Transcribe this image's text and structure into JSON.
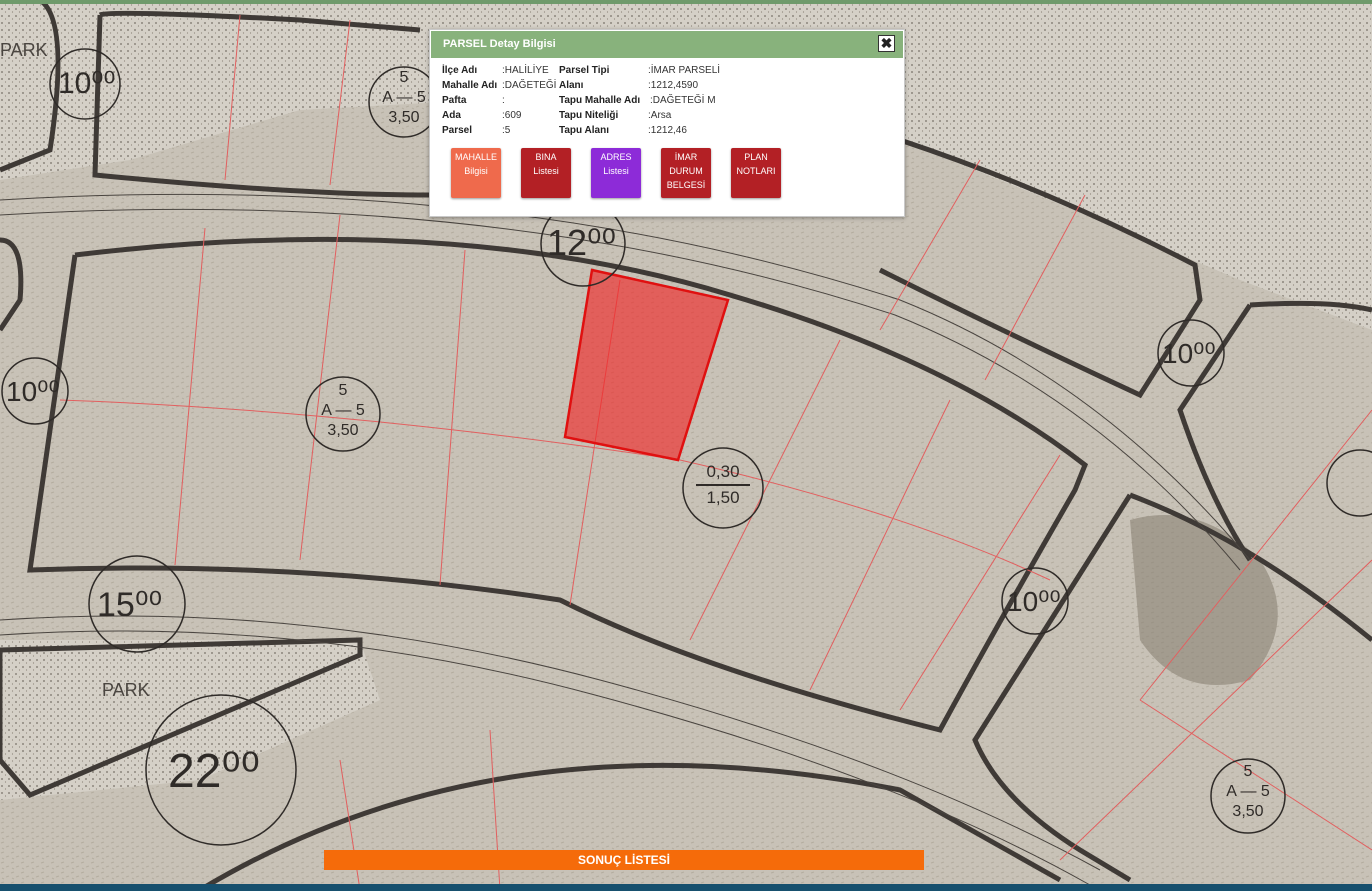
{
  "popup": {
    "title": "PARSEL Detay Bilgisi",
    "close_icon": "close-icon",
    "left_rows": [
      {
        "label": "İlçe Adı",
        "value": ":HALİLİYE"
      },
      {
        "label": "Mahalle Adı",
        "value": ":DAĞETEĞİ"
      },
      {
        "label": "Pafta",
        "value": ":"
      },
      {
        "label": "Ada",
        "value": ":609"
      },
      {
        "label": "Parsel",
        "value": ":5"
      }
    ],
    "right_rows": [
      {
        "label": "Parsel Tipi",
        "value": ":İMAR PARSELİ"
      },
      {
        "label": "Alanı",
        "value": ":1212,4590"
      },
      {
        "label": "Tapu Mahalle Adı",
        "value": ":DAĞETEĞİ M"
      },
      {
        "label": "Tapu Niteliği",
        "value": ":Arsa"
      },
      {
        "label": "Tapu Alanı",
        "value": ":1212,46"
      }
    ],
    "buttons": [
      {
        "line1": "MAHALLE",
        "line2": "Bilgisi",
        "line3": "",
        "color": "#ef6a4c"
      },
      {
        "line1": "BINA",
        "line2": "Listesi",
        "line3": "",
        "color": "#b32025"
      },
      {
        "line1": "ADRES",
        "line2": "Listesi",
        "line3": "",
        "color": "#8d2bd8"
      },
      {
        "line1": "İMAR",
        "line2": "DURUM",
        "line3": "BELGESİ",
        "color": "#b32025"
      },
      {
        "line1": "PLAN",
        "line2": "NOTLARI",
        "line3": "",
        "color": "#b32025"
      }
    ]
  },
  "result_bar": {
    "label": "SONUÇ LİSTESİ",
    "color": "#f56b0a"
  },
  "map_labels": {
    "road_widths": [
      "10⁰⁰",
      "12⁰⁰",
      "10⁰⁰",
      "10⁰⁰",
      "10⁰⁰",
      "15⁰⁰",
      "22⁰⁰"
    ],
    "areas": [
      "PARK",
      "PARK"
    ],
    "zoning": [
      {
        "top": "5",
        "mid": "A — 5",
        "bottom": "3,50"
      },
      {
        "top": "5",
        "mid": "A — 5",
        "bottom": "3,50"
      },
      {
        "top": "5",
        "mid": "A — 5",
        "bottom": "3,50"
      }
    ],
    "ratio": {
      "top": "0,30",
      "bottom": "1,50"
    }
  },
  "colors": {
    "selected_parcel": "#f02a2a",
    "parcel_lines": "#e25f5f",
    "header": "#88b27c",
    "bottom_bar": "#17506e"
  }
}
